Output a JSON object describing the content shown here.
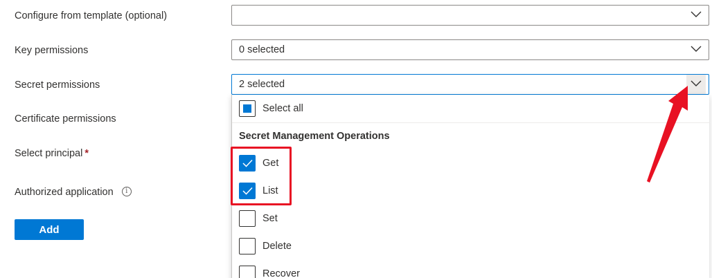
{
  "form": {
    "template_label": "Configure from template (optional)",
    "template_value": "",
    "key_label": "Key permissions",
    "key_value": "0 selected",
    "secret_label": "Secret permissions",
    "secret_value": "2 selected",
    "certificate_label": "Certificate permissions",
    "principal_label": "Select principal",
    "principal_required": "*",
    "authorized_label": "Authorized application",
    "info_glyph": "i",
    "add_label": "Add"
  },
  "dropdown": {
    "select_all_label": "Select all",
    "select_all_state": "partial",
    "group_heading": "Secret Management Operations",
    "options": [
      {
        "label": "Get",
        "checked": true
      },
      {
        "label": "List",
        "checked": true
      },
      {
        "label": "Set",
        "checked": false
      },
      {
        "label": "Delete",
        "checked": false
      },
      {
        "label": "Recover",
        "checked": false
      }
    ]
  },
  "icons": {
    "chevron": "chevron-down-icon",
    "info": "info-icon",
    "check": "checkmark-icon"
  },
  "colors": {
    "accent": "#0078d4",
    "annotation_red": "#e81123",
    "required": "#a4262c"
  }
}
